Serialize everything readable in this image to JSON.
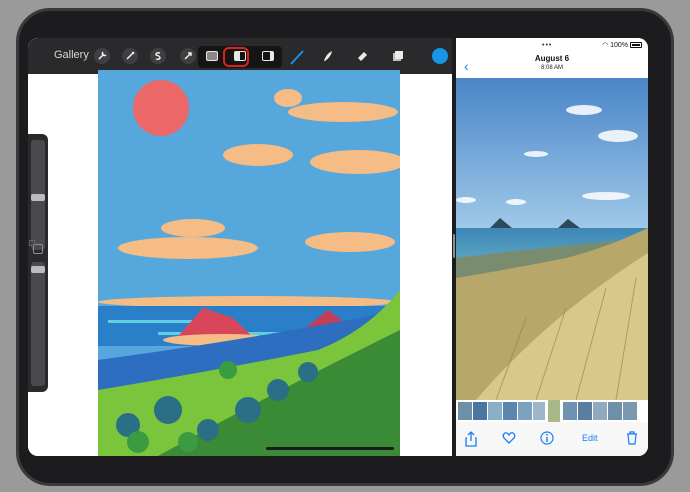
{
  "left_app": {
    "gallery_label": "Gallery",
    "tools": [
      {
        "name": "wrench-icon"
      },
      {
        "name": "magic-wand-icon"
      },
      {
        "name": "selection-s-icon"
      },
      {
        "name": "transform-arrow-icon"
      }
    ],
    "split_options": [
      "full-screen-icon",
      "split-left-icon",
      "split-right-icon"
    ],
    "selected_split": "split-left-icon",
    "right_tools": [
      "brush-icon",
      "smudge-icon",
      "eraser-icon",
      "layers-icon"
    ],
    "color_swatch": "#1796e6",
    "highlight_color": "#e0201b"
  },
  "right_app": {
    "status_dots": "•••",
    "battery_text": "100%",
    "title": "August 6",
    "time": "8:08 AM",
    "actions": {
      "share_icon": "share-icon",
      "like_icon": "heart-icon",
      "info_icon": "info-icon",
      "edit_label": "Edit",
      "delete_icon": "trash-icon"
    },
    "accent_color": "#1a7cf5"
  }
}
